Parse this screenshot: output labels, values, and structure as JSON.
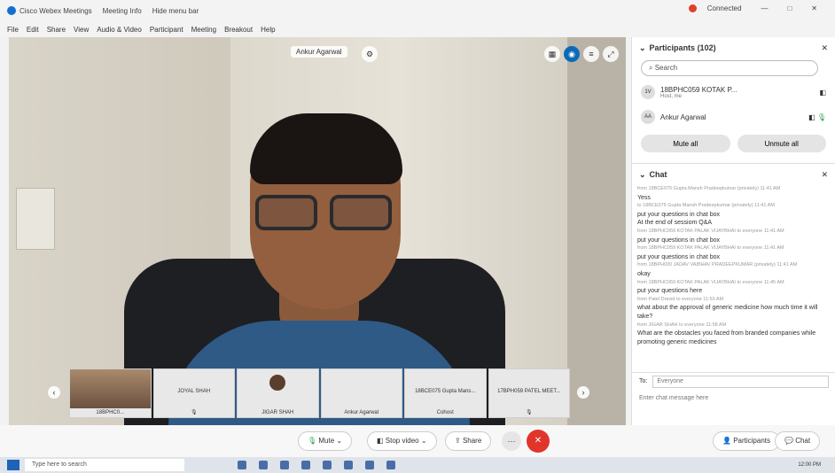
{
  "titlebar": {
    "app_name": "Cisco Webex Meetings",
    "meeting_info": "Meeting Info",
    "hide_menu": "Hide menu bar",
    "connection": "Connected"
  },
  "menubar": {
    "items": [
      "File",
      "Edit",
      "Share",
      "View",
      "Audio & Video",
      "Participant",
      "Meeting",
      "Breakout",
      "Help"
    ]
  },
  "video": {
    "speaker_label": "Ankur Agarwal"
  },
  "filmstrip": [
    {
      "name": "18BPHC0...",
      "status": ""
    },
    {
      "name": "JOYAL SHAH",
      "status": ""
    },
    {
      "name": "JIGAR SHAH",
      "status": ""
    },
    {
      "name": "Ankur Agarwal",
      "status": ""
    },
    {
      "name": "18BCE075 Gupta Mans...",
      "status": "Cohost"
    },
    {
      "name": "17BPH059 PATEL MEET...",
      "status": ""
    }
  ],
  "participants": {
    "title": "Participants (102)",
    "search_placeholder": "Search",
    "list": [
      {
        "initials": "1V",
        "name": "18BPHC059 KOTAK P...",
        "meta": "Host, me"
      },
      {
        "initials": "AA",
        "name": "Ankur Agarwal",
        "meta": ""
      }
    ],
    "mute_all": "Mute all",
    "unmute_all": "Unmute all"
  },
  "chat": {
    "title": "Chat",
    "messages": [
      {
        "from": "from 18BCE075 Gupta Mansh Pradeepkumar (privately)   11:41 AM",
        "text": "Yess"
      },
      {
        "from": "to 18BCE075 Gupta Mansh Pradeepkumar (privately)   11:41 AM",
        "text": "put your questions  in chat box"
      },
      {
        "from": "",
        "text": "At the end of sessiom Q&A"
      },
      {
        "from": "from 18BPHC059 KOTAK PALAK VIJAYBHAI to everyone   11:41 AM",
        "text": "put your questions  in chat box"
      },
      {
        "from": "from 18BPHC059 KOTAK PALAK VIJAYBHAI to everyone   11:41 AM",
        "text": "put your questions  in chat box"
      },
      {
        "from": "from 18BPH030 JADAV VAIBHAV PRADEEPKUMAR (privately)   11:41 AM",
        "text": "okay"
      },
      {
        "from": "from 18BPHC059 KOTAK PALAK VIJAYBHAI to everyone   11:45 AM",
        "text": "put your questions here"
      },
      {
        "from": "from Patel Dravid to everyone   11:50 AM",
        "text": "what about the approval of generic medicine how much time it will take?"
      },
      {
        "from": "from JIGAR SHAH to everyone   11:58 AM",
        "text": "What are the obstacles you faced from branded companies while promoting generic medicines"
      }
    ],
    "to_label": "To:",
    "to_value": "Everyone",
    "input_placeholder": "Enter chat message here"
  },
  "controls": {
    "mute": "Mute",
    "stop_video": "Stop video",
    "share": "Share",
    "participants": "Participants",
    "chat": "Chat"
  },
  "taskbar": {
    "search_placeholder": "Type here to search",
    "time": "12:00 PM"
  }
}
